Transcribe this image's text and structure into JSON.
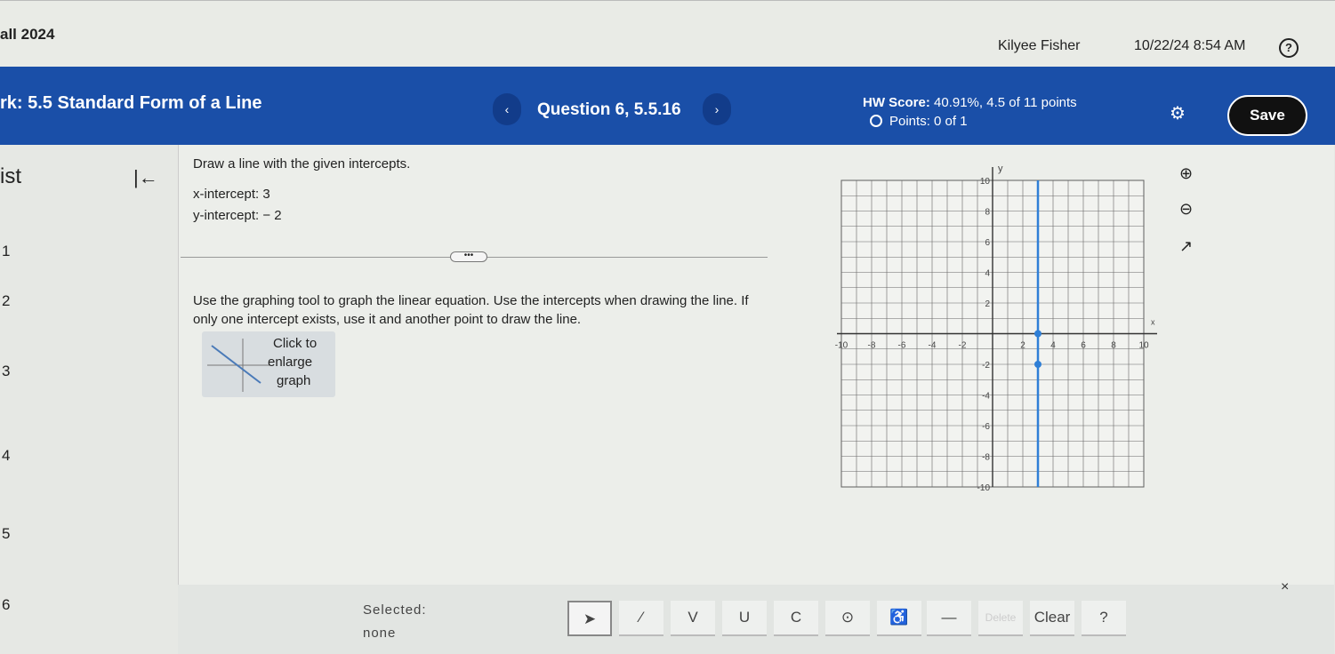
{
  "header": {
    "course": "all 2024",
    "user": "Kilyee Fisher",
    "datetime": "10/22/24 8:54 AM",
    "help": "?"
  },
  "bar": {
    "title": "rk:  5.5 Standard Form of a Line",
    "question": "Question 6, 5.5.16",
    "prev": "‹",
    "next": "›",
    "hw_score_label": "HW Score:",
    "hw_score_value": "40.91%, 4.5 of 11 points",
    "points": "Points: 0 of 1",
    "save": "Save",
    "gear": "⚙"
  },
  "sidebar": {
    "title": "ist",
    "back": "|←",
    "items": [
      "1",
      "2",
      "3",
      "4",
      "5",
      "6"
    ]
  },
  "question": {
    "prompt": "Draw a line with the given intercepts.",
    "x_intercept": "x-intercept: 3",
    "y_intercept": "y-intercept:  − 2",
    "more": "•••",
    "instructions": "Use the graphing tool to graph the linear equation. Use the intercepts when drawing the line. If only one intercept exists, use it and another point to draw the line.",
    "enlarge": [
      "Click to",
      "enlarge",
      "graph"
    ]
  },
  "graph": {
    "xlabel": "x",
    "ylabel": "y",
    "xlim": [
      -10,
      10
    ],
    "ylim": [
      -10,
      10
    ],
    "xticks": [
      "-10",
      "-8",
      "-6",
      "-4",
      "-2",
      "2",
      "4",
      "6",
      "8",
      "10"
    ],
    "yticks": [
      "10",
      "8",
      "6",
      "4",
      "2",
      "-2",
      "-4",
      "-6",
      "-8",
      "-10"
    ],
    "line_color": "#2f7fd6",
    "points": [
      [
        3,
        0
      ],
      [
        3,
        -2
      ]
    ],
    "line": "x = 3 (vertical)"
  },
  "graph_tools": {
    "zoom_in": "⊕",
    "zoom_out": "⊖",
    "popout": "↗"
  },
  "toolbar": {
    "selected_label": "Selected:",
    "selected_value": "none",
    "tools": [
      "➤",
      "⁄",
      "V",
      "U",
      "C",
      "⊙",
      "♿",
      "—",
      "Delete",
      "Clear",
      "?"
    ],
    "close": "×"
  }
}
